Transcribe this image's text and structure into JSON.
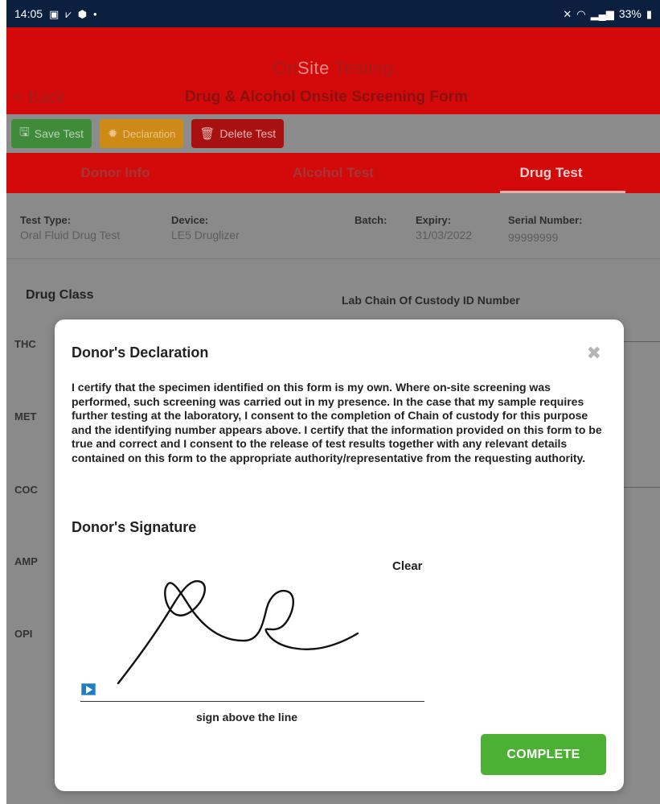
{
  "status_bar": {
    "time": "14:05",
    "battery": "33%",
    "icons": [
      "gallery-icon",
      "download-done-icon",
      "shield-icon",
      "dot-icon",
      "mute-icon",
      "wifi-icon",
      "signal-icon",
      "battery-icon"
    ]
  },
  "header": {
    "brand_part1": "On",
    "brand_part2": "Site",
    "brand_part3": " Testing",
    "back_label": "< Back",
    "title": "Drug & Alcohol Onsite Screening Form"
  },
  "toolbar": {
    "save_label": "Save Test",
    "declaration_label": "Declaration",
    "delete_label": "Delete Test"
  },
  "tabs": [
    {
      "label": "Donor Info"
    },
    {
      "label": "Alcohol Test"
    },
    {
      "label": "Drug Test"
    }
  ],
  "test_info": {
    "test_type_label": "Test Type:",
    "test_type_value": "Oral Fluid Drug Test",
    "device_label": "Device:",
    "device_value": "LE5 Druglizer",
    "batch_label": "Batch:",
    "expiry_label": "Expiry:",
    "expiry_value": "31/03/2022",
    "serial_label": "Serial Number:",
    "serial_value": "99999999"
  },
  "drug_section": {
    "drug_class_heading": "Drug Class",
    "chain_heading": "Lab Chain Of Custody ID Number",
    "drugs": [
      "THC",
      "MET",
      "COC",
      "AMP",
      "OPI"
    ]
  },
  "modal": {
    "title": "Donor's Declaration",
    "body": "I certify that the specimen identified on this form is my own. Where on-site screening was performed, such screening was carried out in my presence. In the case that my sample requires further testing at the laboratory, I consent to the completion of Chain of custody for this purpose and the identifying number appears above. I certify that the information provided on this form to be true and correct and I consent to the release of test results together with any relevant details contained on this form to the appropriate authority/representative from the requesting authority.",
    "signature_heading": "Donor's Signature",
    "clear_label": "Clear",
    "signature_caption": "sign above the line",
    "complete_label": "COMPLETE"
  },
  "colors": {
    "brand_red": "#d40a0a",
    "status_bar": "#0b1f3f",
    "complete_green": "#4cb035",
    "save_green": "#3f8b3a",
    "declaration_orange": "#ce8a16",
    "delete_red": "#a91111"
  }
}
